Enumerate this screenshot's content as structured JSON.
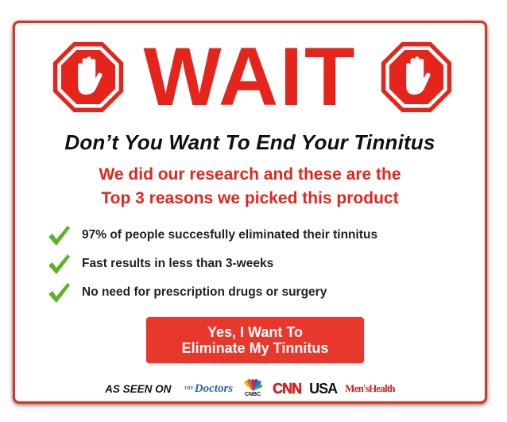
{
  "title": "WAIT",
  "headline": "Don’t You Want To End Your Tinnitus",
  "subheadline": {
    "line1": "We did our research and these are the",
    "line2": "Top 3 reasons we picked this product"
  },
  "benefits": [
    {
      "text": "97% of people succesfully eliminated their tinnitus",
      "icon": "check-icon"
    },
    {
      "text": "Fast results in less than 3-weeks",
      "icon": "check-icon"
    },
    {
      "text": "No need for prescription drugs or surgery",
      "icon": "check-icon"
    }
  ],
  "cta": {
    "line1": "Yes, I Want To",
    "line2": "Eliminate My Tinnitus"
  },
  "as_seen_on": {
    "label": "AS SEEN ON",
    "logos": {
      "doctors_prefix": "THE",
      "doctors": "Doctors",
      "cnbc": "CNBC",
      "cnn": "CNN",
      "usa": "USA",
      "menshealth": "Men'sHealth"
    }
  },
  "colors": {
    "accent_red": "#e5251c",
    "button_red": "#e8382b",
    "check_green": "#5cb326",
    "text_dark": "#111111"
  }
}
